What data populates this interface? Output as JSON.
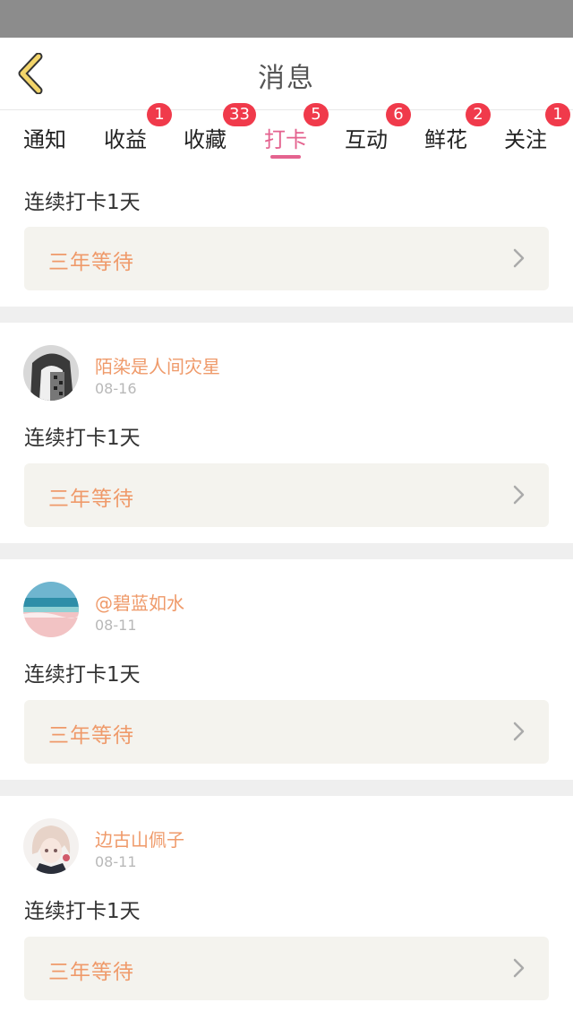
{
  "header": {
    "title": "消息"
  },
  "tabs": [
    {
      "label": "通知",
      "badge": ""
    },
    {
      "label": "收益",
      "badge": "1"
    },
    {
      "label": "收藏",
      "badge": "33"
    },
    {
      "label": "打卡",
      "badge": "5",
      "active": true
    },
    {
      "label": "互动",
      "badge": "6"
    },
    {
      "label": "鲜花",
      "badge": "2"
    },
    {
      "label": "关注",
      "badge": "1"
    }
  ],
  "items": [
    {
      "user": "",
      "date": "",
      "text": "连续打卡1天",
      "book": "三年等待"
    },
    {
      "user": "陌染是人间灾星",
      "date": "08-16",
      "text": "连续打卡1天",
      "book": "三年等待"
    },
    {
      "user": "@碧蓝如水",
      "date": "08-11",
      "text": "连续打卡1天",
      "book": "三年等待"
    },
    {
      "user": "边古山佩子",
      "date": "08-11",
      "text": "连续打卡1天",
      "book": "三年等待"
    }
  ],
  "colors": {
    "accent_pink": "#e4638f",
    "badge_red": "#f03a4b",
    "name_orange": "#ef9a6a",
    "back_icon_yellow": "#f3d56a"
  },
  "icons": {
    "back": "chevron-left-icon",
    "row_arrow": "chevron-right-icon"
  }
}
